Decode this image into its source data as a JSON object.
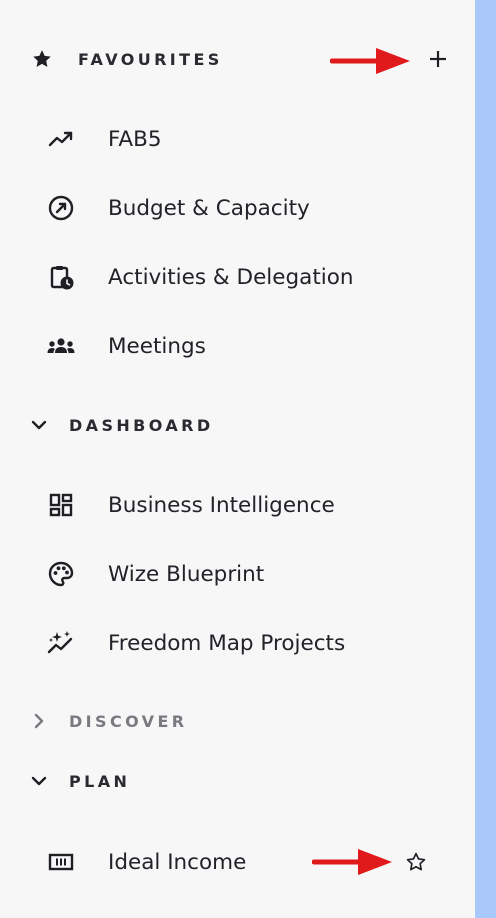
{
  "favourites": {
    "title": "FAVOURITES",
    "icon": "star-icon",
    "add_icon": "plus-icon",
    "items": [
      {
        "label": "FAB5",
        "icon": "trending-up-icon"
      },
      {
        "label": "Budget & Capacity",
        "icon": "gauge-icon"
      },
      {
        "label": "Activities & Delegation",
        "icon": "clipboard-clock-icon"
      },
      {
        "label": "Meetings",
        "icon": "group-icon"
      }
    ]
  },
  "dashboard": {
    "title": "DASHBOARD",
    "expanded": true,
    "items": [
      {
        "label": "Business Intelligence",
        "icon": "dashboard-grid-icon"
      },
      {
        "label": "Wize Blueprint",
        "icon": "palette-icon"
      },
      {
        "label": "Freedom Map Projects",
        "icon": "sparkle-chart-icon"
      }
    ]
  },
  "discover": {
    "title": "DISCOVER",
    "expanded": false
  },
  "plan": {
    "title": "PLAN",
    "expanded": true,
    "items": [
      {
        "label": "Ideal Income",
        "icon": "money-icon",
        "favourite_icon": "star-outline-icon"
      }
    ]
  },
  "colors": {
    "background": "#f7f7f8",
    "right_strip": "#aac9fb",
    "annotation_arrow": "#e0191b",
    "text": "#222228",
    "muted_text": "#7a7a80"
  }
}
